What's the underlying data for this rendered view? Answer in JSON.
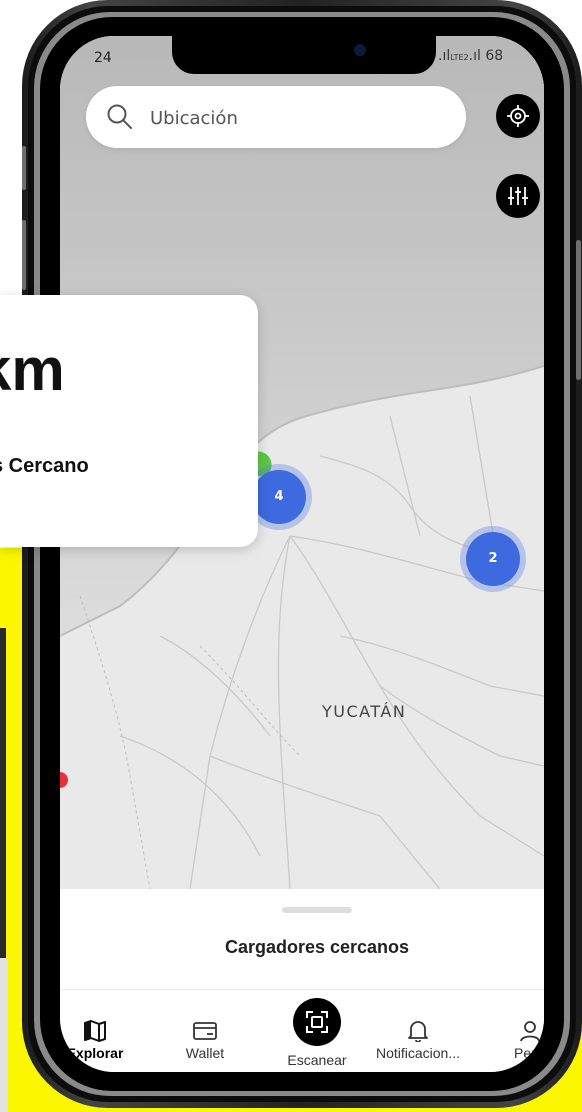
{
  "status": {
    "time": "24",
    "right": "68"
  },
  "search": {
    "placeholder": "Ubicación"
  },
  "map": {
    "region_label": "YUCATÁN",
    "clusters": [
      {
        "count": "4"
      },
      {
        "count": "2"
      }
    ]
  },
  "sheet": {
    "title": "Cargadores cercanos"
  },
  "tabs": [
    {
      "label": "Explorar",
      "icon": "map-icon",
      "active": true
    },
    {
      "label": "Wallet",
      "icon": "wallet-icon"
    },
    {
      "label": "Escanear",
      "icon": "scan-icon"
    },
    {
      "label": "Notificacion...",
      "icon": "bell-icon"
    },
    {
      "label": "Perfil",
      "icon": "user-icon"
    }
  ],
  "overlay": {
    "distance": "km",
    "caption": "s Cercano"
  },
  "colors": {
    "accent_yellow": "#fbf700",
    "cluster_blue": "#3e6ae0",
    "marker_red": "#e8303f",
    "marker_green": "#5cc648"
  }
}
